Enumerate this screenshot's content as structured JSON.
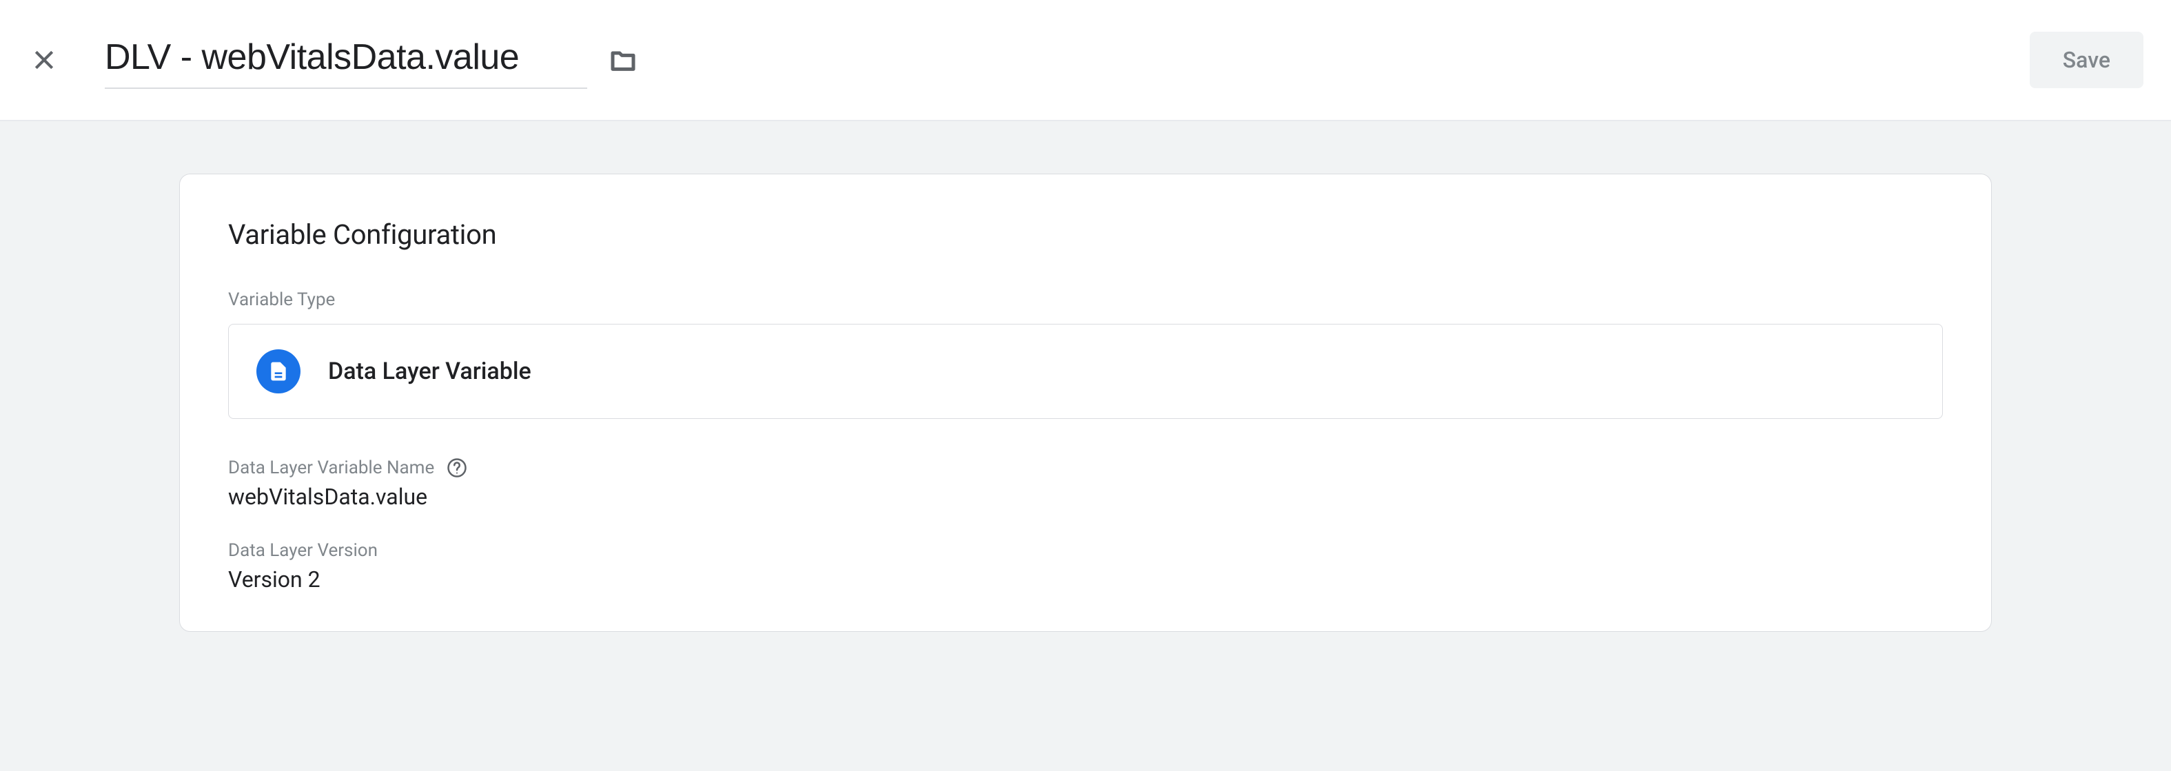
{
  "header": {
    "title": "DLV - webVitalsData.value",
    "save_label": "Save"
  },
  "card": {
    "title": "Variable Configuration",
    "type_section_label": "Variable Type",
    "type_name": "Data Layer Variable",
    "fields": {
      "name": {
        "label": "Data Layer Variable Name",
        "value": "webVitalsData.value"
      },
      "version": {
        "label": "Data Layer Version",
        "value": "Version 2"
      }
    }
  }
}
